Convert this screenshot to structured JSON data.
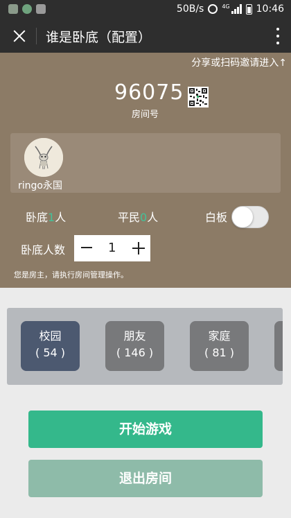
{
  "status_bar": {
    "network_speed": "50B/s",
    "network_type": "4G",
    "time": "10:46"
  },
  "header": {
    "title": "谁是卧底（配置）",
    "close_icon": "close-icon",
    "more_icon": "more-vertical-icon"
  },
  "room": {
    "share_hint": "分享或扫码邀请进入↑",
    "number": "96075",
    "number_label": "房间号",
    "player": {
      "name": "ringo永国"
    },
    "spy_prefix": "卧底",
    "spy_count": "1",
    "spy_suffix": "人",
    "civilian_prefix": "平民",
    "civilian_count": "0",
    "civilian_suffix": "人",
    "blank_label": "白板",
    "blank_enabled": false,
    "spy_count_label": "卧底人数",
    "stepper_value": "1",
    "owner_note": "您是房主，请执行房间管理操作。"
  },
  "categories": [
    {
      "name": "校园",
      "count": "( 54 )",
      "selected": true
    },
    {
      "name": "朋友",
      "count": "( 146 )",
      "selected": false
    },
    {
      "name": "家庭",
      "count": "( 81 )",
      "selected": false
    }
  ],
  "buttons": {
    "start": "开始游戏",
    "exit": "退出房间"
  },
  "colors": {
    "header": "#2e2e2e",
    "panel": "#8c7b66",
    "accent": "#34b88b",
    "count_green": "#43c29a",
    "selected_category": "#4c5970"
  }
}
